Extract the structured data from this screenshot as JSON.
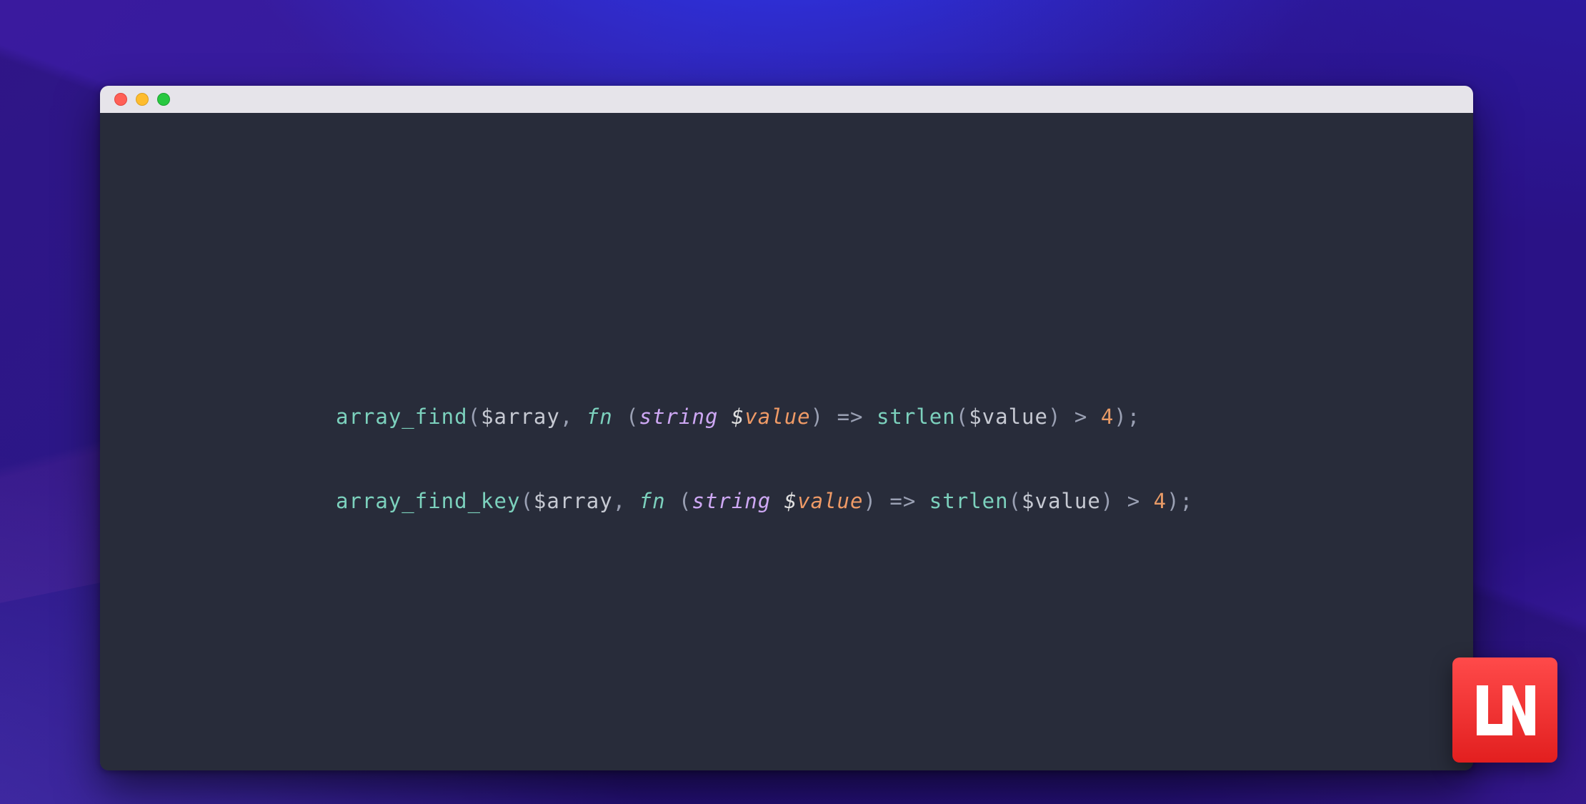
{
  "window": {
    "traffic": {
      "close": "close",
      "min": "minimize",
      "zoom": "zoom"
    }
  },
  "code": {
    "l1": {
      "fn": "array_find",
      "open": "(",
      "arrSig": "$",
      "arrVar": "array",
      "comma": ", ",
      "kw": "fn ",
      "open2": "(",
      "type": "string ",
      "argSig": "$",
      "argVar": "value",
      "close2": ")",
      "arrow": " => ",
      "fn2": "strlen",
      "open3": "(",
      "valSig": "$",
      "valVar": "value",
      "close3": ")",
      "op": " > ",
      "num": "4",
      "close": ")",
      "semi": ";"
    },
    "l2": {
      "fn": "array_find_key",
      "open": "(",
      "arrSig": "$",
      "arrVar": "array",
      "comma": ", ",
      "kw": "fn ",
      "open2": "(",
      "type": "string ",
      "argSig": "$",
      "argVar": "value",
      "close2": ")",
      "arrow": " => ",
      "fn2": "strlen",
      "open3": "(",
      "valSig": "$",
      "valVar": "value",
      "close3": ")",
      "op": " > ",
      "num": "4",
      "close": ")",
      "semi": ";"
    }
  },
  "badge": {
    "label": "LN"
  }
}
